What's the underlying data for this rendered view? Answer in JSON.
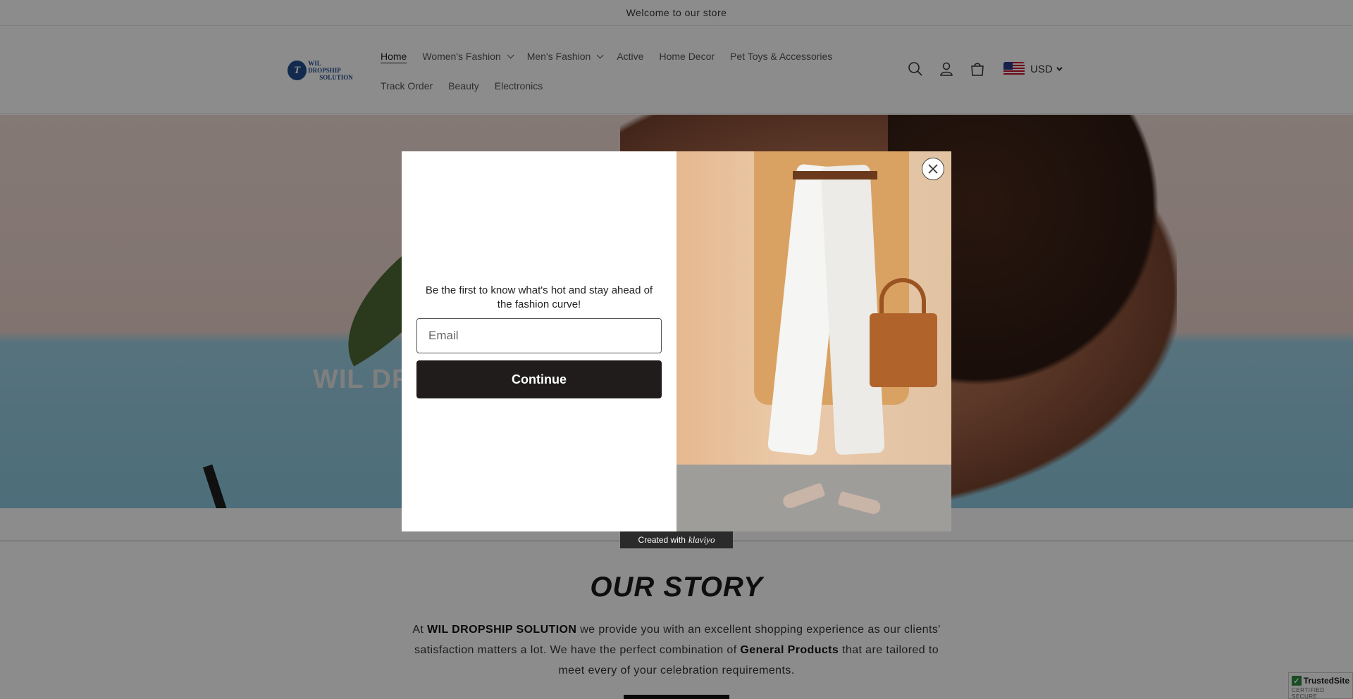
{
  "announcement": "Welcome to our store",
  "header": {
    "logo": {
      "mark": "T",
      "line1": "WIL DROPSHIP",
      "line2": "SOLUTION"
    },
    "nav_row1": [
      {
        "label": "Home",
        "active": true,
        "dropdown": false
      },
      {
        "label": "Women's Fashion",
        "active": false,
        "dropdown": true
      },
      {
        "label": "Men's Fashion",
        "active": false,
        "dropdown": true
      },
      {
        "label": "Active",
        "active": false,
        "dropdown": false
      },
      {
        "label": "Home Decor",
        "active": false,
        "dropdown": false
      },
      {
        "label": "Pet Toys & Accessories",
        "active": false,
        "dropdown": false
      }
    ],
    "nav_row2": [
      {
        "label": "Track Order"
      },
      {
        "label": "Beauty"
      },
      {
        "label": "Electronics"
      }
    ],
    "icons": [
      "search-icon",
      "account-icon",
      "cart-icon"
    ],
    "currency": "USD"
  },
  "hero": {
    "title": "WIL DR"
  },
  "popup": {
    "message": "Be the first to know what's hot and stay ahead of the fashion curve!",
    "email_placeholder": "Email",
    "continue_label": "Continue",
    "badge_prefix": "Created with",
    "badge_brand": "klaviyo"
  },
  "story": {
    "title": "OUR STORY",
    "p1": "At ",
    "brand": "WIL DROPSHIP SOLUTION",
    "p2": " we provide you with an excellent shopping experience as our clients' satisfaction matters a lot. We have the perfect combination of ",
    "products": "General Products",
    "p3": " that are tailored to meet every of your celebration requirements."
  },
  "trusted": {
    "name": "TrustedSite",
    "sub": "CERTIFIED SECURE"
  },
  "colors": {
    "button_dark": "#1f1c1b",
    "logo_blue": "#1f4d8f",
    "overlay": "rgba(0,0,0,0.45)"
  }
}
